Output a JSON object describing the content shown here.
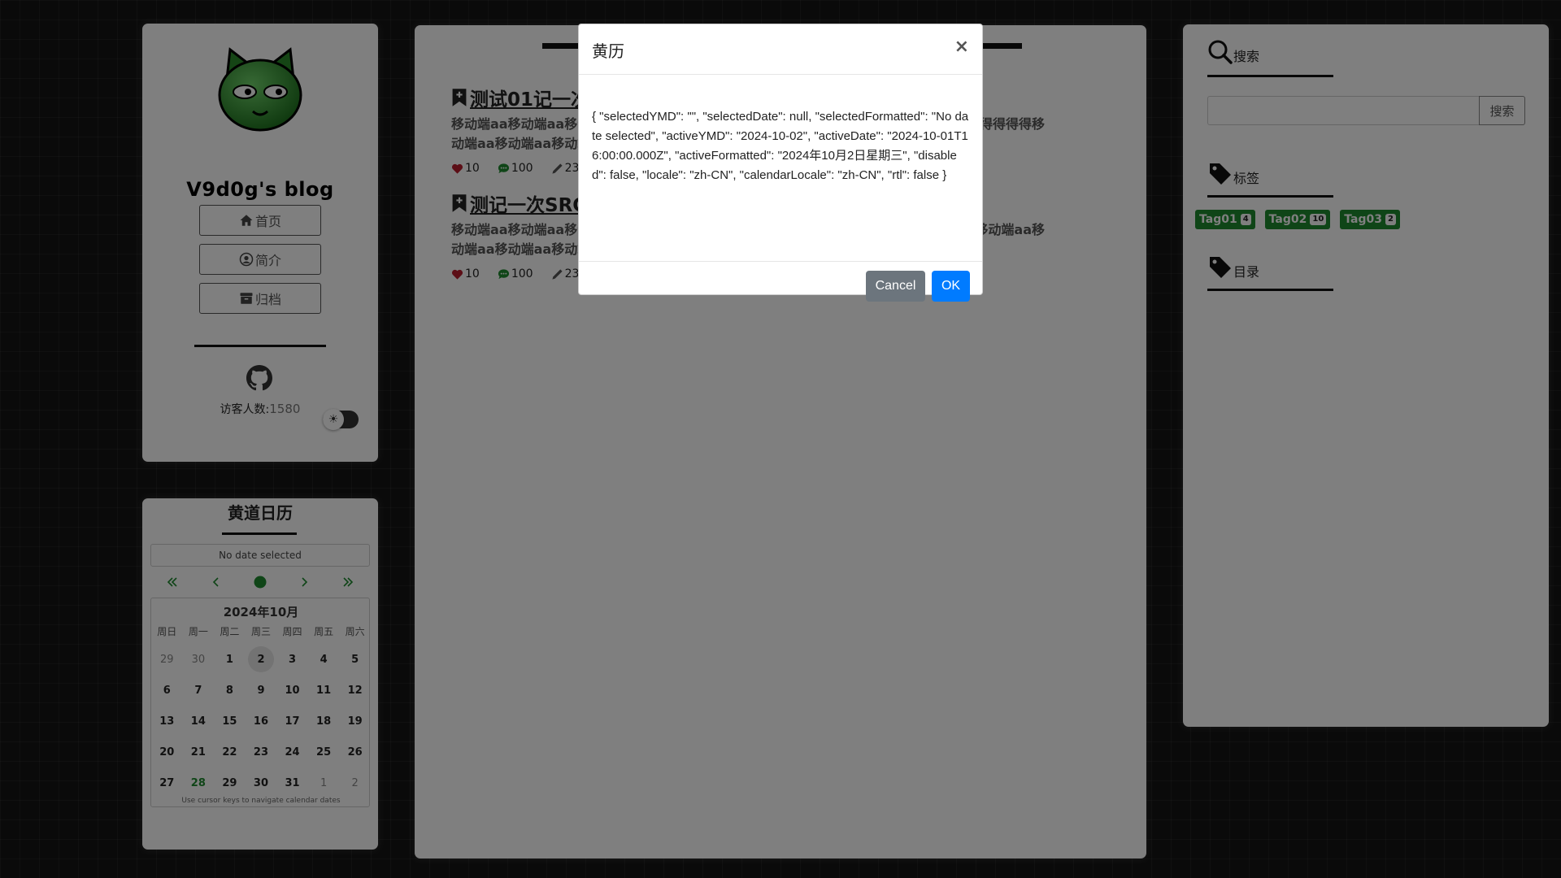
{
  "profile": {
    "blog_title": "V9d0g's blog",
    "nav": [
      {
        "label": "首页",
        "icon": "home-icon"
      },
      {
        "label": "简介",
        "icon": "user-icon"
      },
      {
        "label": "归档",
        "icon": "archive-icon"
      }
    ],
    "visitors_label": "访客人数:",
    "visitors_count": "1580",
    "theme_toggle_icon": "☀"
  },
  "calendar": {
    "title": "黄道日历",
    "selected_text": "No date selected",
    "month_label": "2024年10月",
    "weekdays": [
      "周日",
      "周一",
      "周二",
      "周三",
      "周四",
      "周五",
      "周六"
    ],
    "weeks": [
      [
        "29",
        "30",
        "1",
        "2",
        "3",
        "4",
        "5"
      ],
      [
        "6",
        "7",
        "8",
        "9",
        "10",
        "11",
        "12"
      ],
      [
        "13",
        "14",
        "15",
        "16",
        "17",
        "18",
        "19"
      ],
      [
        "20",
        "21",
        "22",
        "23",
        "24",
        "25",
        "26"
      ],
      [
        "27",
        "28",
        "29",
        "30",
        "31",
        "1",
        "2"
      ]
    ],
    "help_text": "Use cursor keys to navigate calendar dates",
    "accent_color": "#1e8a2e"
  },
  "posts": [
    {
      "title": "测试01记一次",
      "excerpt_left": "移动端aa移动端aa移动",
      "excerpt_right": "得得得得移",
      "excerpt_line2": "动端aa移动端aa移动端",
      "likes": "10",
      "comments": "100",
      "edits": "23"
    },
    {
      "title": "测记一次SRC",
      "excerpt_left": "移动端aa移动端aa移动",
      "excerpt_right": "移动端aa移",
      "excerpt_line2": "动端aa移动端aa移动端",
      "likes": "10",
      "comments": "100",
      "edits": "23"
    }
  ],
  "sidebar": {
    "search_heading": "搜索",
    "search_button": "搜索",
    "tags_heading": "标签",
    "toc_heading": "目录",
    "tags": [
      {
        "label": "Tag01",
        "count": "4"
      },
      {
        "label": "Tag02",
        "count": "10"
      },
      {
        "label": "Tag03",
        "count": "2"
      }
    ]
  },
  "modal": {
    "title": "黄历",
    "close": "×",
    "body": "{ \"selectedYMD\": \"\", \"selectedDate\": null, \"selectedFormatted\": \"No date selected\", \"activeYMD\": \"2024-10-02\", \"activeDate\": \"2024-10-01T16:00:00.000Z\", \"activeFormatted\": \"2024年10月2日星期三\", \"disabled\": false, \"locale\": \"zh-CN\", \"calendarLocale\": \"zh-CN\", \"rtl\": false }",
    "cancel_label": "Cancel",
    "ok_label": "OK"
  }
}
